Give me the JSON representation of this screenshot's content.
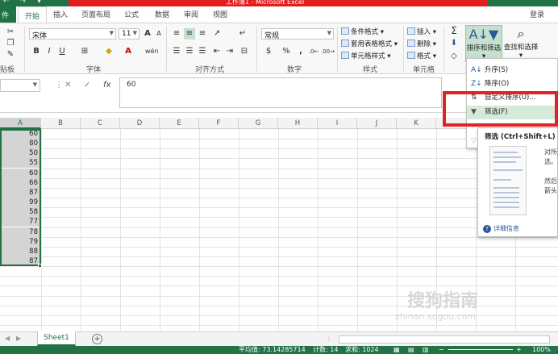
{
  "window": {
    "title": "工作簿1 - Microsoft Excel",
    "qat": "↶ ↷ ▾"
  },
  "tabs": {
    "file": "件",
    "items": [
      "开始",
      "插入",
      "页面布局",
      "公式",
      "数据",
      "审阅",
      "视图"
    ],
    "login": "登录"
  },
  "ribbon": {
    "font_name": "宋体",
    "font_size": "11",
    "number_format": "常规",
    "groups": {
      "clipboard": "贴板",
      "font": "字体",
      "alignment": "对齐方式",
      "number": "数字",
      "styles": "样式",
      "cells": "单元格"
    },
    "styles_items": [
      "条件格式 ▾",
      "套用表格格式 ▾",
      "单元格样式 ▾"
    ],
    "cells_items": [
      "插入 ▾",
      "删除 ▾",
      "格式 ▾"
    ],
    "sort_filter": "排序和筛选",
    "find_select": "查找和选择",
    "bold": "B",
    "italic": "I",
    "underline": "U",
    "grow": "A",
    "shrink": "A",
    "font_color": "A",
    "percent": "%",
    "comma": ",",
    "currency": "$",
    "sigma": "Σ"
  },
  "formula_bar": {
    "value": "60",
    "cancel": "✕",
    "enter": "✓",
    "fx": "fx"
  },
  "columns": [
    "A",
    "B",
    "C",
    "D",
    "E",
    "F",
    "G",
    "H",
    "I",
    "J",
    "K"
  ],
  "cells_A": [
    "60",
    "80",
    "50",
    "55",
    "60",
    "66",
    "87",
    "99",
    "58",
    "77",
    "78",
    "79",
    "88",
    "87"
  ],
  "sheet": {
    "tab": "Sheet1",
    "add": "+"
  },
  "status": {
    "average": "平均值: 73.14285714",
    "count": "计数: 14",
    "sum": "求和: 1024",
    "zoom": "100%"
  },
  "sort_menu": {
    "items": [
      {
        "label": "升序(S)",
        "icon": "sort-asc-icon",
        "glyph": "A↓"
      },
      {
        "label": "降序(O)",
        "icon": "sort-desc-icon",
        "glyph": "Z↓"
      },
      {
        "label": "自定义排序(U)...",
        "icon": "custom-sort-icon",
        "glyph": "⇅"
      },
      {
        "label": "筛选(F)",
        "icon": "filter-icon",
        "glyph": "▼"
      }
    ]
  },
  "tooltip": {
    "title": "筛选 (Ctrl+Shift+L)",
    "lines": [
      "对所选",
      "选。",
      "然后",
      "箭头"
    ],
    "more": "详细信息"
  },
  "watermark": {
    "main": "搜狗指南",
    "sub": "zhinan.sogou.com"
  },
  "colors": {
    "excel_green": "#217346",
    "highlight_red": "#e02424"
  }
}
